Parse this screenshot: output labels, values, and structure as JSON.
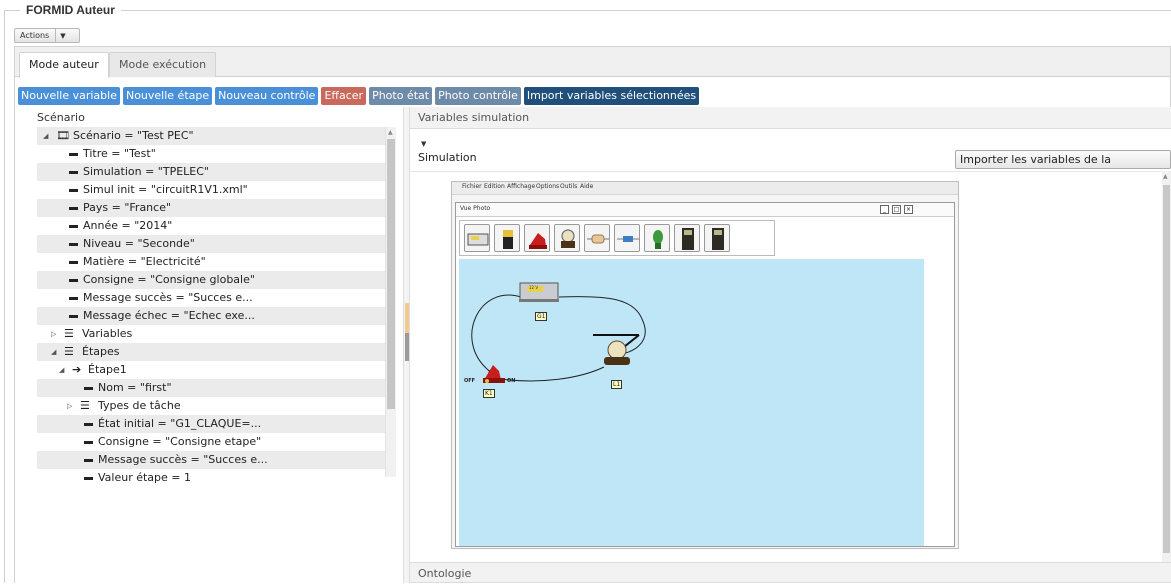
{
  "app": {
    "title": "FORMID Auteur",
    "actions_label": "Actions"
  },
  "tabs": [
    {
      "label": "Mode auteur",
      "active": true
    },
    {
      "label": "Mode exécution",
      "active": false
    }
  ],
  "toolbar": {
    "buttons": [
      {
        "label": "Nouvelle variable",
        "color": "#4a90d9"
      },
      {
        "label": "Nouvelle étape",
        "color": "#4a90d9"
      },
      {
        "label": "Nouveau contrôle",
        "color": "#4a90d9"
      },
      {
        "label": "Effacer",
        "color": "#c9685d"
      },
      {
        "label": "Photo état",
        "color": "#6d8aa8"
      },
      {
        "label": "Photo contrôle",
        "color": "#6d8aa8"
      },
      {
        "label": "Import variables sélectionnées",
        "color": "#1f4f7a"
      }
    ]
  },
  "scenario": {
    "title": "Scénario",
    "tree": [
      {
        "text": "Scénario = \"Test PEC\""
      },
      {
        "text": "Titre = \"Test\""
      },
      {
        "text": "Simulation = \"TPELEC\""
      },
      {
        "text": "Simul init = \"circuitR1V1.xml\""
      },
      {
        "text": "Pays = \"France\""
      },
      {
        "text": "Année = \"2014\""
      },
      {
        "text": "Niveau = \"Seconde\""
      },
      {
        "text": "Matière = \"Electricité\""
      },
      {
        "text": "Consigne = \"Consigne globale\""
      },
      {
        "text": "Message succès = \"Succes e..."
      },
      {
        "text": "Message échec = \"Echec exe..."
      },
      {
        "text": "Variables"
      },
      {
        "text": "Étapes"
      },
      {
        "text": "Étape1"
      },
      {
        "text": "Nom = \"first\""
      },
      {
        "text": "Types de tâche"
      },
      {
        "text": "État initial = \"G1_CLAQUE=..."
      },
      {
        "text": "Consigne = \"Consigne etape\""
      },
      {
        "text": "Message succès = \"Succes e..."
      },
      {
        "text": "Valeur étape = 1"
      }
    ]
  },
  "variables_panel": {
    "title": "Variables simulation",
    "simulation_label": "Simulation",
    "import_button": "Importer les variables de la simulation"
  },
  "simulation_app": {
    "menu": [
      "Fichier",
      "Edition",
      "Affichage",
      "Options",
      "Outils",
      "Aide"
    ],
    "window_title": "Vue Photo",
    "components": {
      "g1": "G1",
      "l1": "L1",
      "k1": "K1",
      "off": "OFF",
      "on": "ON",
      "readout": "12 V"
    }
  },
  "ontology_panel": {
    "title": "Ontologie"
  }
}
